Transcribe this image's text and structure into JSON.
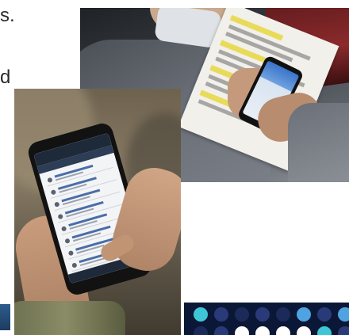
{
  "text_fragments": {
    "top": "s.",
    "middle": "d"
  },
  "colors": {
    "background": "#ffffff",
    "dots_background": "#0b1736",
    "dot_teal": "#3ec6d6",
    "dot_white": "#ffffff",
    "dot_navy": "#2a3a78",
    "dot_blue": "#4fa3e0"
  }
}
